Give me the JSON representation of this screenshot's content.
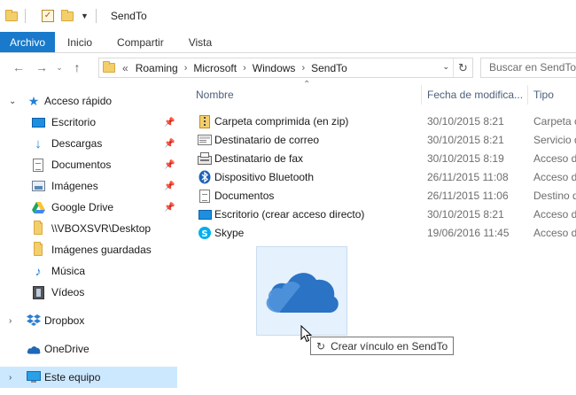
{
  "window": {
    "title": "SendTo"
  },
  "ribbon": {
    "tabs": [
      "Archivo",
      "Inicio",
      "Compartir",
      "Vista"
    ]
  },
  "address": {
    "overflow": "«",
    "crumbs": [
      "Roaming",
      "Microsoft",
      "Windows",
      "SendTo"
    ],
    "separator": "›"
  },
  "search": {
    "placeholder": "Buscar en SendTo"
  },
  "columns": {
    "name": "Nombre",
    "date": "Fecha de modifica...",
    "type": "Tipo"
  },
  "nav": {
    "items": [
      {
        "label": "Acceso rápido",
        "icon": "star-icon"
      },
      {
        "label": "Escritorio",
        "icon": "desktop-icon",
        "pinned": true
      },
      {
        "label": "Descargas",
        "icon": "download-icon",
        "pinned": true
      },
      {
        "label": "Documentos",
        "icon": "documents-icon",
        "pinned": true
      },
      {
        "label": "Imágenes",
        "icon": "pictures-icon",
        "pinned": true
      },
      {
        "label": "Google Drive",
        "icon": "google-drive-icon",
        "pinned": true
      },
      {
        "label": "\\\\VBOXSVR\\Desktop",
        "icon": "folder-icon"
      },
      {
        "label": "Imágenes guardadas",
        "icon": "folder-icon"
      },
      {
        "label": "Música",
        "icon": "music-icon"
      },
      {
        "label": "Vídeos",
        "icon": "videos-icon"
      },
      {
        "label": "Dropbox",
        "icon": "dropbox-icon"
      },
      {
        "label": "OneDrive",
        "icon": "onedrive-icon"
      },
      {
        "label": "Este equipo",
        "icon": "this-pc-icon"
      }
    ]
  },
  "files": [
    {
      "name": "Carpeta comprimida (en zip)",
      "date": "30/10/2015 8:21",
      "type": "Carpeta c",
      "icon": "zip-folder-icon"
    },
    {
      "name": "Destinatario de correo",
      "date": "30/10/2015 8:21",
      "type": "Servicio d",
      "icon": "mail-recipient-icon"
    },
    {
      "name": "Destinatario de fax",
      "date": "30/10/2015 8:19",
      "type": "Acceso d",
      "icon": "fax-recipient-icon"
    },
    {
      "name": "Dispositivo Bluetooth",
      "date": "26/11/2015 11:08",
      "type": "Acceso d",
      "icon": "bluetooth-icon"
    },
    {
      "name": "Documentos",
      "date": "26/11/2015 11:06",
      "type": "Destino d",
      "icon": "documents-icon"
    },
    {
      "name": "Escritorio (crear acceso directo)",
      "date": "30/10/2015 8:21",
      "type": "Acceso d",
      "icon": "desktop-icon"
    },
    {
      "name": "Skype",
      "date": "19/06/2016 11:45",
      "type": "Acceso d",
      "icon": "skype-icon"
    }
  ],
  "drag": {
    "tooltip": "Crear vínculo en SendTo",
    "icon": "onedrive-cloud-icon"
  },
  "colors": {
    "accent": "#1979ca",
    "selection": "#cce8ff",
    "folder": "#f3cf6b",
    "onedrive": "#2b73c4"
  }
}
